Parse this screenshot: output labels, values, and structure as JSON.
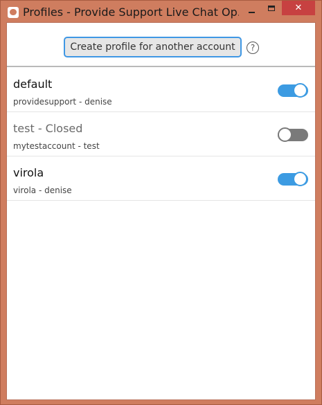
{
  "window": {
    "title": "Profiles - Provide Support Live Chat Op...",
    "title_bar_color": "#cf7d5f",
    "close_button_color": "#c74141",
    "app_icon": "chat-bubble-icon"
  },
  "toolbar": {
    "create_profile_label": "Create profile for another account",
    "help_label": "?",
    "help_icon": "help-circle-icon"
  },
  "profiles": [
    {
      "name": "default",
      "detail": "providesupport - denise",
      "enabled": true
    },
    {
      "name": "test - Closed",
      "detail": "mytestaccount - test",
      "enabled": false
    },
    {
      "name": "virola",
      "detail": "virola - denise",
      "enabled": true
    }
  ],
  "colors": {
    "toggle_on": "#3c9be2",
    "toggle_off": "#7a7a7a",
    "button_focus_border": "#3f97e4"
  }
}
